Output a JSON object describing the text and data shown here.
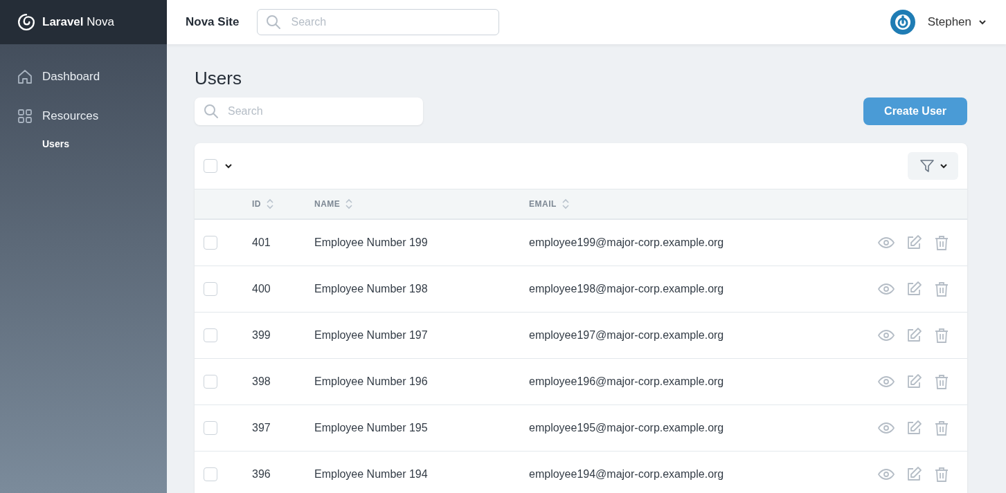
{
  "brand": {
    "name_bold": "Laravel",
    "name_light": "Nova"
  },
  "header": {
    "site": "Nova Site",
    "search": {
      "placeholder": "Search"
    },
    "user": "Stephen"
  },
  "sidebar": {
    "items": [
      {
        "label": "Dashboard",
        "kind": "home",
        "selected": false
      },
      {
        "label": "Resources",
        "kind": "grid",
        "selected": false,
        "children": [
          {
            "label": "Users",
            "selected": true
          }
        ]
      }
    ]
  },
  "page": {
    "title": "Users",
    "search": {
      "placeholder": "Search"
    },
    "create_button": "Create User"
  },
  "table": {
    "select_all_checked": false,
    "columns": [
      "ID",
      "NAME",
      "EMAIL"
    ],
    "rows": [
      {
        "checked": false,
        "id": "401",
        "name": "Employee Number 199",
        "email": "employee199@major-corp.example.org"
      },
      {
        "checked": false,
        "id": "400",
        "name": "Employee Number 198",
        "email": "employee198@major-corp.example.org"
      },
      {
        "checked": false,
        "id": "399",
        "name": "Employee Number 197",
        "email": "employee197@major-corp.example.org"
      },
      {
        "checked": false,
        "id": "398",
        "name": "Employee Number 196",
        "email": "employee196@major-corp.example.org"
      },
      {
        "checked": false,
        "id": "397",
        "name": "Employee Number 195",
        "email": "employee195@major-corp.example.org"
      },
      {
        "checked": false,
        "id": "396",
        "name": "Employee Number 194",
        "email": "employee194@major-corp.example.org"
      }
    ]
  }
}
